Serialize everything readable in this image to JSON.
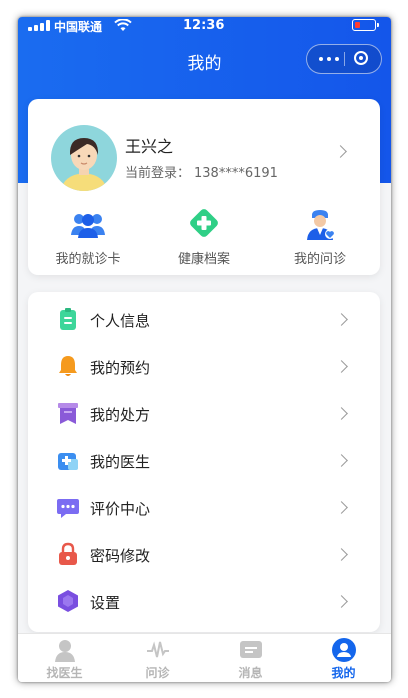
{
  "status_bar": {
    "carrier": "中国联通",
    "time": "12:36"
  },
  "nav": {
    "title": "我的"
  },
  "profile": {
    "name": "王兴之",
    "login_label": "当前登录：",
    "phone": "138****6191"
  },
  "quick_actions": [
    {
      "label": "我的就诊卡",
      "icon": "users-icon"
    },
    {
      "label": "健康档案",
      "icon": "health-cross-icon"
    },
    {
      "label": "我的问诊",
      "icon": "doctor-icon"
    }
  ],
  "menu": [
    {
      "label": "个人信息",
      "icon": "clipboard-icon",
      "color": "#3dd69a"
    },
    {
      "label": "我的预约",
      "icon": "bell-icon",
      "color": "#f59a1e"
    },
    {
      "label": "我的处方",
      "icon": "prescription-icon",
      "color": "#8a5ad8"
    },
    {
      "label": "我的医生",
      "icon": "medical-kit-icon",
      "color": "#3b8ef0"
    },
    {
      "label": "评价中心",
      "icon": "chat-bubble-icon",
      "color": "#7b6cf2"
    },
    {
      "label": "密码修改",
      "icon": "lock-icon",
      "color": "#e8584a"
    },
    {
      "label": "设置",
      "icon": "hexagon-settings-icon",
      "color": "#7a4fe0"
    }
  ],
  "tabs": [
    {
      "label": "找医生",
      "icon": "doctor-search-icon",
      "active": false
    },
    {
      "label": "问诊",
      "icon": "pulse-icon",
      "active": false
    },
    {
      "label": "消息",
      "icon": "message-icon",
      "active": false
    },
    {
      "label": "我的",
      "icon": "user-circle-icon",
      "active": true
    }
  ],
  "colors": {
    "primary": "#1466ec",
    "background": "#f4f5f7"
  }
}
